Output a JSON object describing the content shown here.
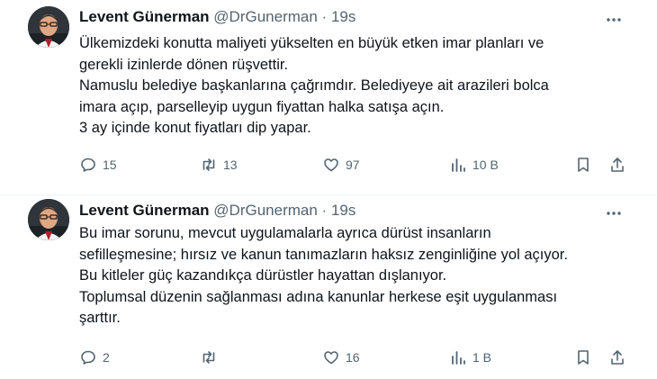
{
  "tweets": [
    {
      "author_name": "Levent Günerman",
      "handle": "@DrGunerman",
      "separator": "·",
      "time": "19s",
      "lines": [
        "Ülkemizdeki konutta maliyeti yükselten en büyük etken imar planları ve",
        "gerekli izinlerde dönen rüşvettir.",
        "Namuslu belediye başkanlarına çağrımdır. Belediyeye ait arazileri bolca",
        "imara açıp, parselleyip uygun fiyattan halka satışa açın.",
        "3 ay içinde konut fiyatları dip yapar."
      ],
      "replies": "15",
      "retweets": "13",
      "likes": "97",
      "views": "10 B"
    },
    {
      "author_name": "Levent Günerman",
      "handle": "@DrGunerman",
      "separator": "·",
      "time": "19s",
      "lines": [
        "Bu imar sorunu, mevcut uygulamalarla ayrıca dürüst insanların",
        "sefilleşmesine; hırsız ve kanun tanımazların haksız zenginliğine yol açıyor.",
        "Bu kitleler güç kazandıkça dürüstler hayattan dışlanıyor.",
        "Toplumsal düzenin sağlanması adına kanunlar herkese eşit uygulanması",
        "şarttır."
      ],
      "replies": "2",
      "retweets": "",
      "likes": "16",
      "views": "1 B"
    }
  ],
  "icons": [
    "avatar",
    "more-icon",
    "reply-icon",
    "retweet-icon",
    "like-icon",
    "views-icon",
    "bookmark-icon",
    "share-icon"
  ],
  "colors": {
    "text": "#0f1419",
    "muted": "#536471",
    "background": "#ffffff"
  }
}
